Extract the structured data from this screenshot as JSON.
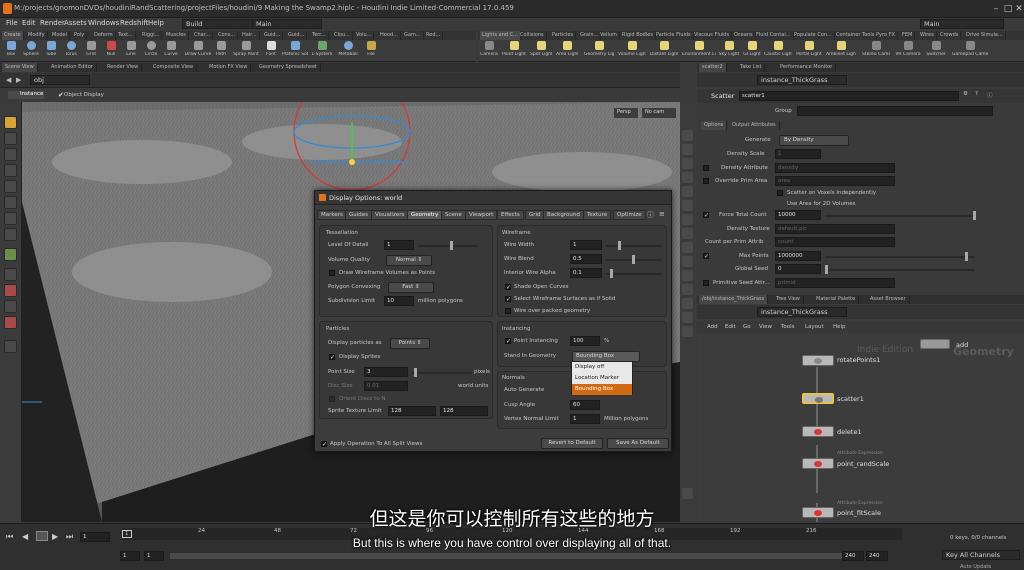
{
  "window": {
    "title": "M:/projects/gnomonDVDs/houdiniRandScattering/projectFiles/houdini/9 Making the Swamp2.hiplc - Houdini Indie Limited-Commercial 17.0.459"
  },
  "menu": [
    "File",
    "Edit",
    "Render",
    "Assets",
    "Windows",
    "Redshift",
    "Help"
  ],
  "desktop_left": "Build",
  "desktop_right": "Main",
  "shelf_tabs_left": [
    "Create",
    "Modify",
    "Model",
    "Poly",
    "Deform",
    "Text...",
    "Riggi...",
    "Muscles",
    "Char...",
    "Cons...",
    "Hair...",
    "Guid...",
    "Guid...",
    "Terr...",
    "Clou...",
    "Volu...",
    "Hood...",
    "Gam...",
    "Red..."
  ],
  "shelf_tools_left": [
    "Box",
    "Sphere",
    "Tube",
    "Torus",
    "Grid",
    "Null",
    "Line",
    "Circle",
    "Curve",
    "Draw Curve",
    "Path",
    "Spray Paint",
    "Font",
    "Platonic Solids",
    "L-System",
    "Metaball",
    "File"
  ],
  "shelf_tabs_right": [
    "Lights and C...",
    "Collisions",
    "Particles",
    "Grain...",
    "Vellum",
    "Rigid Bodies",
    "Particle Fluids",
    "Viscous Fluids",
    "Oceans",
    "Fluid Contai...",
    "Populate Con...",
    "Container Tools",
    "Pyro FX",
    "FEM",
    "Wires",
    "Crowds",
    "Drive Simula..."
  ],
  "shelf_tools_right": [
    "Camera",
    "Point Light",
    "Spot Light",
    "Area Light",
    "Geometry Light",
    "Volume Light",
    "Distant Light",
    "Environment Light",
    "Sky Light",
    "GI Light",
    "Caustic Light",
    "Portal Light",
    "Ambient Light",
    "Stereo Camera",
    "VR Camera",
    "Switcher",
    "Gamepad Camera"
  ],
  "pane_tabs_left": [
    "Scene View",
    "Animation Editor",
    "Render View",
    "Composite View",
    "Motion FX View",
    "Geometry Spreadsheet"
  ],
  "path_left": "obj",
  "viewport": {
    "mode": "Instance",
    "display": "Object Display",
    "persp": "Persp",
    "cam": "No cam"
  },
  "dialog": {
    "title": "Display Options: world",
    "tabs": [
      "Markers",
      "Guides",
      "Visualizers",
      "Geometry",
      "Scene",
      "Viewport",
      "Effects",
      "Grid",
      "Background",
      "Texture",
      "Optimize"
    ],
    "active_tab": "Geometry",
    "tessellation": {
      "header": "Tessellation",
      "level_of_detail_label": "Level Of Detail",
      "level_of_detail": "1",
      "volume_quality_label": "Volume Quality",
      "volume_quality": "Normal",
      "draw_wire_label": "Draw Wireframe Volumes as Points",
      "polygon_convexing_label": "Polygon Convexing",
      "polygon_convexing": "Fast",
      "subdivision_limit_label": "Subdivision Limit",
      "subdivision_limit": "10",
      "subdivision_unit": "million polygons"
    },
    "wireframe": {
      "header": "Wireframe",
      "wire_width_label": "Wire Width",
      "wire_width": "1",
      "wire_blend_label": "Wire Blend",
      "wire_blend": "0.5",
      "interior_alpha_label": "Interior Wire Alpha",
      "interior_alpha": "0.1",
      "shade_open_label": "Shade Open Curves",
      "select_wire_label": "Select Wireframe Surfaces as if Solid",
      "wire_packed_label": "Wire over packed geometry"
    },
    "particles": {
      "header": "Particles",
      "display_as_label": "Display particles as",
      "display_as": "Points",
      "display_sprites_label": "Display Sprites",
      "point_size_label": "Point Size",
      "point_size": "3",
      "point_size_unit": "pixels",
      "disc_size_label": "Disc Size",
      "disc_size": "0.01",
      "disc_unit": "world units",
      "orient_discs_label": "Orient Discs to N",
      "sprite_limit_label": "Sprite Texture Limit",
      "sprite_limit_a": "128",
      "sprite_limit_b": "128"
    },
    "instancing": {
      "header": "Instancing",
      "point_instancing_label": "Point Instancing",
      "point_instancing": "100",
      "pct": "%",
      "stand_in_label": "Stand In Geometry",
      "stand_in": "Bounding Box",
      "dropdown": [
        "Display off",
        "Location Marker",
        "Bounding Box"
      ],
      "dropdown_selected": "Bounding Box"
    },
    "normals": {
      "header": "Normals",
      "auto_generate_label": "Auto Generate",
      "cusp_angle_label": "Cusp Angle",
      "cusp_angle": "60",
      "vertex_limit_label": "Vertex Normal Limit",
      "vertex_limit": "1",
      "vertex_unit": "Million polygons"
    },
    "apply_all_label": "Apply Operation To All Split Views",
    "revert_label": "Revert to Default",
    "save_default_label": "Save As Default"
  },
  "params": {
    "tabs": [
      "scatter2",
      "Take List",
      "Performance Monitor"
    ],
    "path": "instance_ThickGrass",
    "node_type": "Scatter",
    "node_name": "scatter1",
    "group_label": "Group",
    "subtabs": [
      "Options",
      "Output Attributes"
    ],
    "generate_label": "Generate",
    "generate": "By Density",
    "density_scale_label": "Density Scale",
    "density_scale": "1",
    "density_attr_label": "Density Attribute",
    "density_attr": "density",
    "override_prim_label": "Override Prim Area",
    "override_prim": "area",
    "scatter_voxels_label": "Scatter on Voxels Independently",
    "use_area_label": "Use Area for 2D Volumes",
    "force_total_label": "Force Total Count",
    "force_total": "10000",
    "density_texture_label": "Density Texture",
    "density_texture": "default.pic",
    "count_prim_label": "Count per Prim Attrib",
    "count_prim": "count",
    "max_points_label": "Max Points",
    "max_points": "1000000",
    "global_seed_label": "Global Seed",
    "global_seed": "0",
    "prim_seed_label": "Primitive Seed Attr...",
    "prim_seed": "primid"
  },
  "network": {
    "tabs": [
      "/obj/instance_ThickGrass",
      "Tree View",
      "Material Palette",
      "Asset Browser"
    ],
    "path": "instance_ThickGrass",
    "menu": [
      "Add",
      "Edit",
      "Go",
      "View",
      "Tools",
      "Layout",
      "Help"
    ],
    "watermark_a": "Indie Edition",
    "watermark_b": "Geometry",
    "nodes": [
      "rotatePoints1",
      "scatter1",
      "delete1",
      "point_randScale",
      "point_fitScale",
      "add"
    ],
    "node_notes": [
      "Attribute Expression",
      "Attribute Expression"
    ]
  },
  "timeline": {
    "ticks": [
      "24",
      "48",
      "72",
      "96",
      "120",
      "144",
      "168",
      "192",
      "216"
    ],
    "frame": "1",
    "start": "1",
    "start2": "1",
    "end": "240",
    "end2": "240",
    "keys": "0 keys, 0/0 channels",
    "key_all": "Key All Channels",
    "auto_update": "Auto Update"
  },
  "subtitles": {
    "zh": "但这是你可以控制所有这些的地方",
    "en": "But this is where you have control over displaying all of that."
  },
  "colors": {
    "accent_orange": "#e2731c",
    "selected_node": "#e8c24a",
    "dropdown_highlight": "#d06a12"
  }
}
